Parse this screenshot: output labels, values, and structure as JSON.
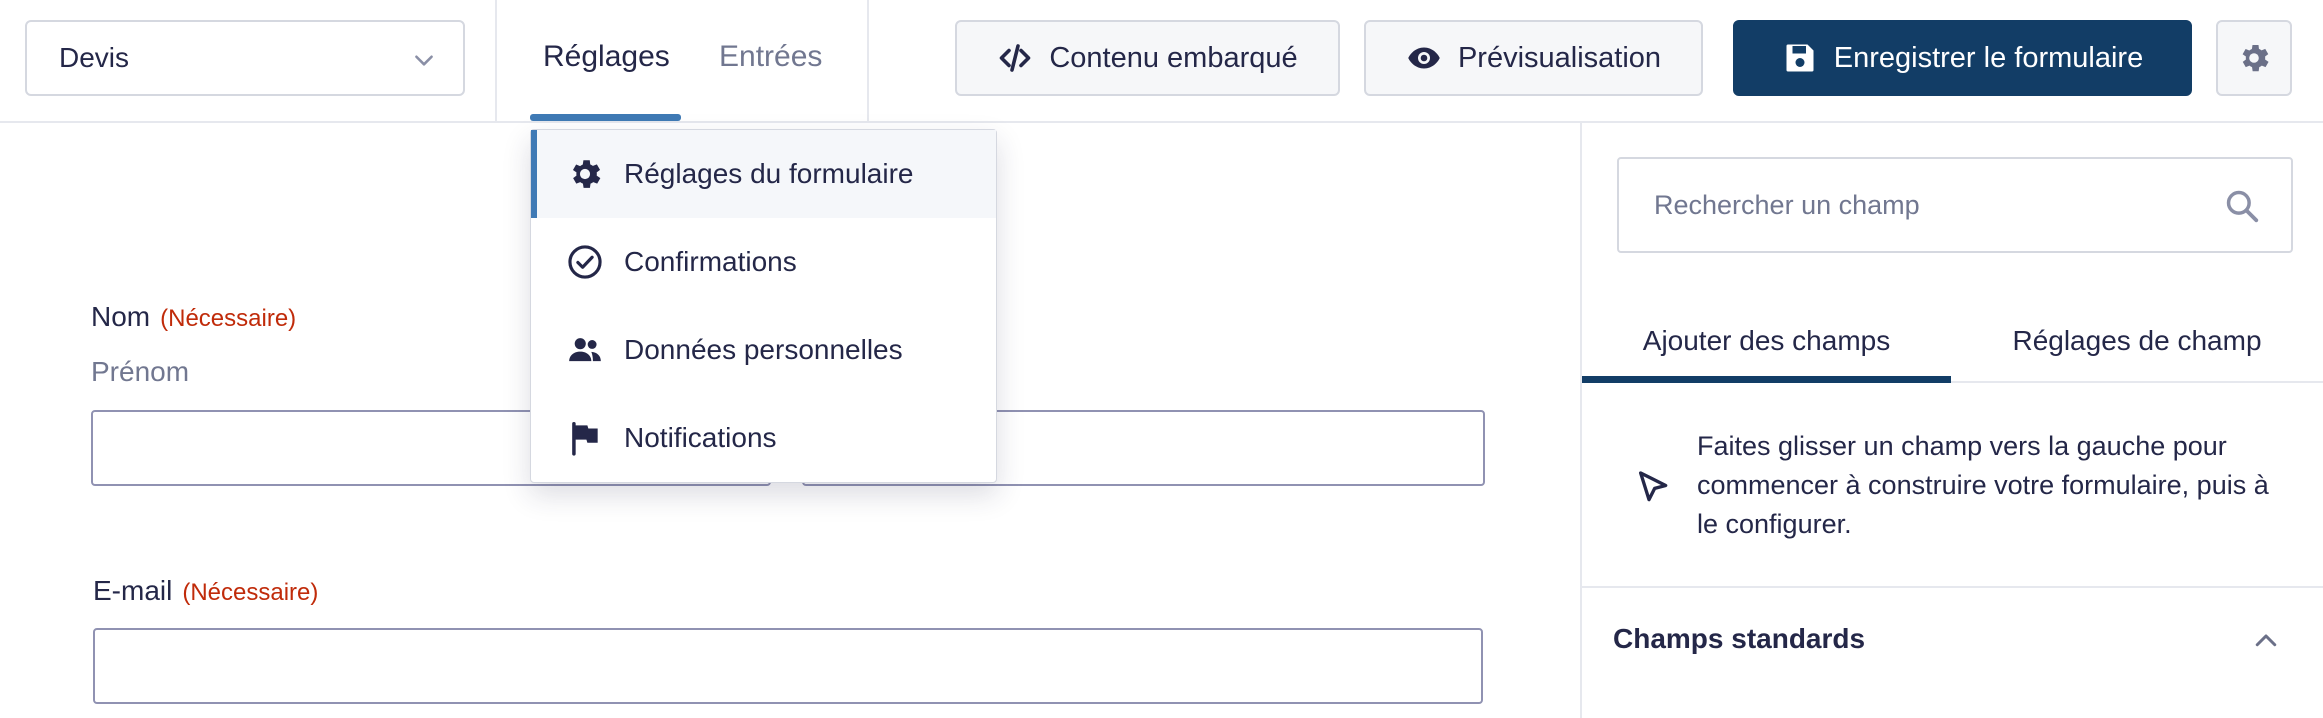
{
  "header": {
    "form_select_value": "Devis",
    "tabs": [
      {
        "label": "Réglages",
        "active": true
      },
      {
        "label": "Entrées",
        "active": false
      }
    ],
    "buttons": {
      "embed_label": "Contenu embarqué",
      "preview_label": "Prévisualisation",
      "save_label": "Enregistrer le formulaire"
    }
  },
  "settings_menu": {
    "items": [
      {
        "label": "Réglages du formulaire",
        "icon": "gear-icon",
        "selected": true
      },
      {
        "label": "Confirmations",
        "icon": "check-circle-icon",
        "selected": false
      },
      {
        "label": "Données personnelles",
        "icon": "users-icon",
        "selected": false
      },
      {
        "label": "Notifications",
        "icon": "flag-icon",
        "selected": false
      }
    ]
  },
  "form": {
    "name_field": {
      "label": "Nom",
      "required_text": "(Nécessaire)",
      "sublabel": "Prénom"
    },
    "email_field": {
      "label": "E-mail",
      "required_text": "(Nécessaire)"
    }
  },
  "sidebar": {
    "search_placeholder": "Rechercher un champ",
    "tabs": [
      {
        "label": "Ajouter des champs",
        "active": true
      },
      {
        "label": "Réglages de champ",
        "active": false
      }
    ],
    "hint": "Faites glisser un champ vers la gauche pour commencer à construire votre formulaire, puis à le configurer.",
    "section_title": "Champs standards"
  },
  "colors": {
    "primary": "#123d66",
    "accent": "#3f7ab5",
    "required": "#c02b0a",
    "text": "#242748",
    "muted": "#717790"
  }
}
